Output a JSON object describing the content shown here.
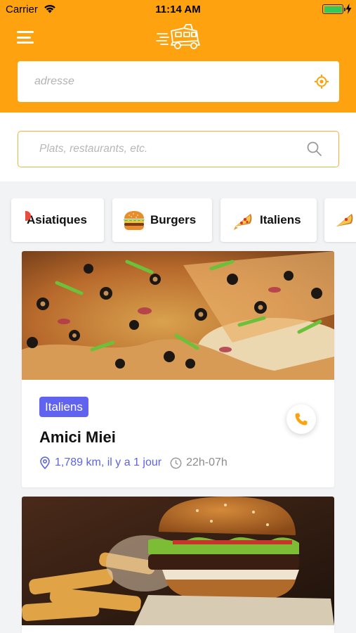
{
  "status_bar": {
    "carrier": "Carrier",
    "time": "11:14 AM"
  },
  "header": {
    "menu_icon": "hamburger-menu-icon",
    "logo_icon": "food-truck-logo-icon",
    "address_placeholder": "adresse",
    "locate_icon": "gps-target-icon"
  },
  "search": {
    "placeholder": "Plats, restaurants, etc.",
    "icon": "search-icon"
  },
  "categories": [
    {
      "label": "Asiatiques",
      "icon": "asian-food-icon"
    },
    {
      "label": "Burgers",
      "icon": "hamburger-icon"
    },
    {
      "label": "Italiens",
      "icon": "pizza-slice-icon"
    },
    {
      "label": "",
      "icon": "pizza-slice-icon"
    }
  ],
  "restaurants": [
    {
      "tag": "Italiens",
      "name": "Amici Miei",
      "distance": "1,789 km, il y a 1 jour",
      "hours": "22h-07h",
      "image": "pizza-photo",
      "call_icon": "phone-icon"
    },
    {
      "image": "burger-photo"
    }
  ],
  "colors": {
    "brand_orange": "#fea30f",
    "badge_purple": "#6063f0",
    "distance_blue": "#5e63e8",
    "search_border": "#f4b13d"
  }
}
